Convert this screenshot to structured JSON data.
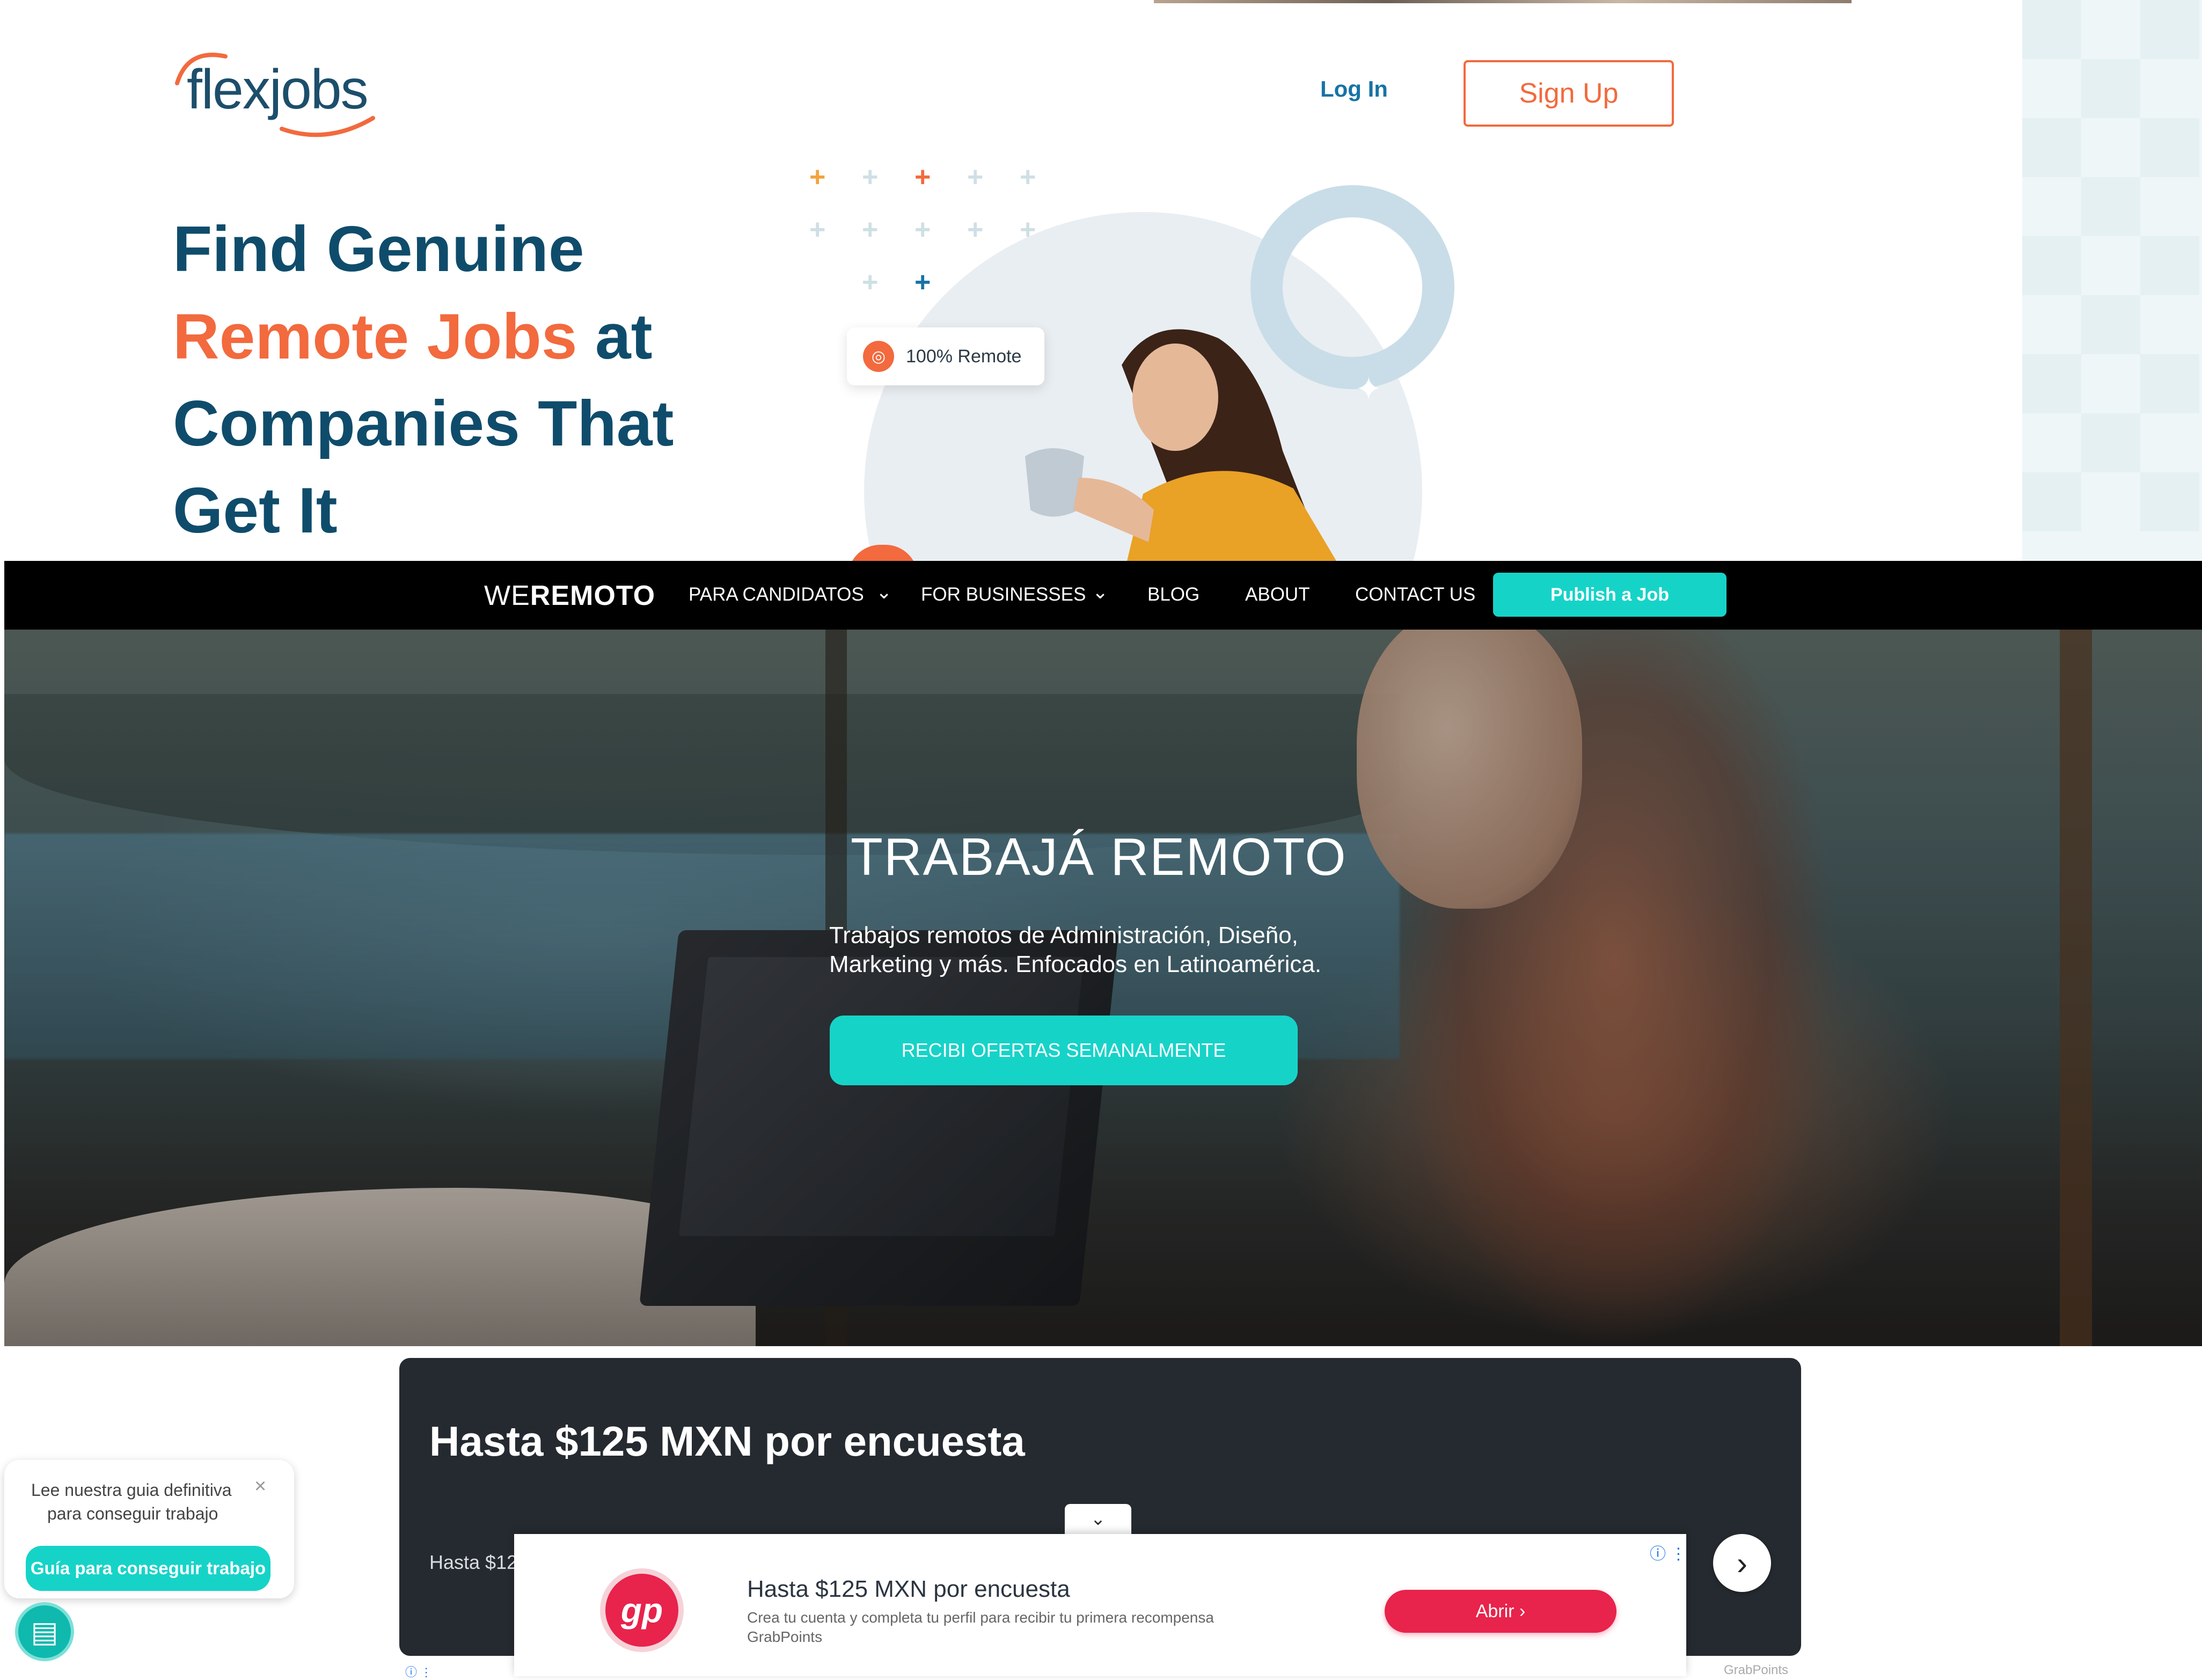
{
  "flexjobs": {
    "logo_text": "flexjobs",
    "login_label": "Log In",
    "signup_label": "Sign Up",
    "headline": {
      "line1": "Find Genuine",
      "line2_accent": "Remote Jobs",
      "line2_rest": " at",
      "line3": "Companies That",
      "line4": "Get It"
    },
    "badge_label": "100% Remote",
    "colors": {
      "brand_blue": "#0f4c6b",
      "accent_orange": "#f26a3e",
      "link_blue": "#1673a6"
    }
  },
  "weremoto": {
    "logo_light": "WE",
    "logo_bold": "REMOTO",
    "nav": {
      "candidates": "PARA CANDIDATOS",
      "businesses": "FOR BUSINESSES",
      "blog": "BLOG",
      "about": "ABOUT",
      "contact": "CONTACT US",
      "chevron": "⌄"
    },
    "publish_label": "Publish a Job",
    "hero": {
      "title": "TRABAJÁ REMOTO",
      "subtitle_line1": "Trabajos remotos de Administración, Diseño,",
      "subtitle_line2": "Marketing y más. Enfocados en Latinoamérica.",
      "cta_label": "RECIBI OFERTAS SEMANALMENTE"
    },
    "colors": {
      "teal": "#16d3c8",
      "nav_bg": "#000000"
    }
  },
  "ad": {
    "card_title": "Hasta $125 MXN por encuesta",
    "card_small": "Hasta $12",
    "collapse_icon": "chevron-down-icon",
    "banner": {
      "logo_text": "gp",
      "title": "Hasta $125 MXN por encuesta",
      "description": "Crea tu cuenta y completa tu perfil para recibir tu primera recompensa",
      "brand": "GrabPoints",
      "cta_label": "Abrir  ›",
      "info_icons": "ⓘ ⋮"
    },
    "next_icon": "chevron-right-icon",
    "footer_brand": "GrabPoints",
    "colors": {
      "card_bg": "#252a30",
      "cta": "#e8234c"
    }
  },
  "guide_popup": {
    "text_line1": "Lee nuestra guia definitiva",
    "text_line2": "para conseguir trabajo",
    "close": "×",
    "button_label": "Guía para conseguir trabajo",
    "icon": "document-info-icon"
  }
}
